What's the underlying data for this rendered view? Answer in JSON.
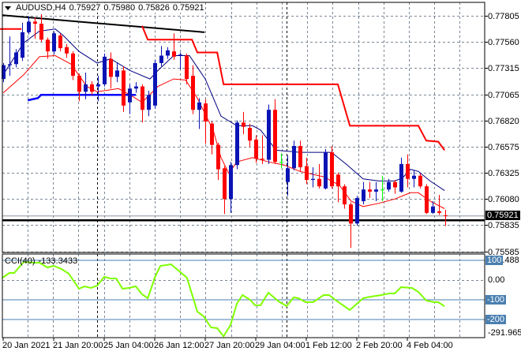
{
  "header": {
    "symbol": "AUDUSD,H4",
    "open": "0.75927",
    "high": "0.75980",
    "low": "0.75826",
    "close": "0.75921"
  },
  "cci": {
    "label": "CCI(40)",
    "value": "-133.3433",
    "scale_labels": [
      "0.00",
      "-291.9651"
    ],
    "max_label": "123.488",
    "level_labels": [
      "100",
      "-100",
      "-200"
    ],
    "color": "#7fff00"
  },
  "price_axis": {
    "labels": [
      "0.77805",
      "0.77560",
      "0.77315",
      "0.77065",
      "0.76820",
      "0.76575",
      "0.76325",
      "0.76080",
      "0.75835",
      "0.75585"
    ],
    "current_price": "0.75921"
  },
  "time_axis": {
    "labels": [
      "20 Jan 2021",
      "21 Jan 20:00",
      "25 Jan 04:00",
      "26 Jan 12:00",
      "27 Jan 20:00",
      "29 Jan 04:00",
      "1 Feb 12:00",
      "2 Feb 20:00",
      "4 Feb 04:00"
    ]
  },
  "colors": {
    "bull": "#0a14b4",
    "bear": "#ff0000",
    "doji": "#00ff00",
    "ma_fast": "#ff0000",
    "ma_slow": "#000080",
    "grid": "#7a8796",
    "trend": "#000000"
  },
  "chart_data": {
    "type": "candlestick",
    "symbol": "AUDUSD",
    "timeframe": "H4",
    "ylim": [
      0.75585,
      0.77805
    ],
    "candles": [
      [
        0.7721,
        0.7736,
        0.7718,
        0.7734
      ],
      [
        0.7734,
        0.7761,
        0.7724,
        0.7735
      ],
      [
        0.7735,
        0.7749,
        0.7732,
        0.7746
      ],
      [
        0.7741,
        0.7774,
        0.7738,
        0.7765
      ],
      [
        0.7765,
        0.778,
        0.7763,
        0.7775
      ],
      [
        0.7775,
        0.7779,
        0.7759,
        0.7773
      ],
      [
        0.7773,
        0.7782,
        0.7756,
        0.7758
      ],
      [
        0.7758,
        0.776,
        0.774,
        0.7747
      ],
      [
        0.7747,
        0.7766,
        0.7744,
        0.7764
      ],
      [
        0.7762,
        0.7764,
        0.7747,
        0.775
      ],
      [
        0.7751,
        0.7754,
        0.7741,
        0.7745
      ],
      [
        0.7745,
        0.7747,
        0.772,
        0.7724
      ],
      [
        0.7724,
        0.7726,
        0.77,
        0.7709
      ],
      [
        0.7709,
        0.7727,
        0.7702,
        0.7716
      ],
      [
        0.7716,
        0.7719,
        0.7706,
        0.7709
      ],
      [
        0.7714,
        0.7724,
        0.77,
        0.7716
      ],
      [
        0.7716,
        0.7745,
        0.7714,
        0.7742
      ],
      [
        0.774,
        0.7746,
        0.7712,
        0.7723
      ],
      [
        0.7723,
        0.7736,
        0.7718,
        0.7729
      ],
      [
        0.7729,
        0.7733,
        0.769,
        0.7696
      ],
      [
        0.7699,
        0.7716,
        0.7688,
        0.7712
      ],
      [
        0.7712,
        0.7718,
        0.7708,
        0.7714
      ],
      [
        0.7714,
        0.7716,
        0.768,
        0.7692
      ],
      [
        0.7692,
        0.771,
        0.7686,
        0.7706
      ],
      [
        0.7696,
        0.7739,
        0.7693,
        0.7736
      ],
      [
        0.7736,
        0.7752,
        0.7733,
        0.7743
      ],
      [
        0.7743,
        0.7751,
        0.774,
        0.7748
      ],
      [
        0.7747,
        0.7764,
        0.7739,
        0.7742
      ],
      [
        0.7743,
        0.7746,
        0.773,
        0.7744
      ],
      [
        0.7743,
        0.7745,
        0.7716,
        0.7721
      ],
      [
        0.7724,
        0.7734,
        0.7688,
        0.7692
      ],
      [
        0.7692,
        0.7703,
        0.7674,
        0.7699
      ],
      [
        0.7698,
        0.7702,
        0.766,
        0.7681
      ],
      [
        0.7679,
        0.7681,
        0.765,
        0.7659
      ],
      [
        0.7659,
        0.7661,
        0.7626,
        0.7636
      ],
      [
        0.7637,
        0.7639,
        0.7594,
        0.7608
      ],
      [
        0.7608,
        0.7643,
        0.7595,
        0.764
      ],
      [
        0.764,
        0.7682,
        0.7636,
        0.768
      ],
      [
        0.768,
        0.769,
        0.7669,
        0.7676
      ],
      [
        0.7675,
        0.7679,
        0.7657,
        0.7663
      ],
      [
        0.7664,
        0.7668,
        0.7642,
        0.7646
      ],
      [
        0.7646,
        0.7668,
        0.7641,
        0.7645
      ],
      [
        0.7645,
        0.7697,
        0.7641,
        0.7692
      ],
      [
        0.7692,
        0.7702,
        0.7641,
        0.7643
      ],
      [
        0.7643,
        0.7651,
        0.7637,
        0.7643
      ],
      [
        0.7624,
        0.7649,
        0.7611,
        0.7637
      ],
      [
        0.7637,
        0.7663,
        0.7635,
        0.7658
      ],
      [
        0.7658,
        0.7663,
        0.7634,
        0.7638
      ],
      [
        0.7639,
        0.7647,
        0.7622,
        0.7626
      ],
      [
        0.7626,
        0.7638,
        0.7619,
        0.7627
      ],
      [
        0.7627,
        0.7641,
        0.7618,
        0.762
      ],
      [
        0.7618,
        0.7655,
        0.7617,
        0.7652
      ],
      [
        0.7652,
        0.7658,
        0.7618,
        0.762
      ],
      [
        0.7631,
        0.7633,
        0.7605,
        0.762
      ],
      [
        0.762,
        0.7622,
        0.7599,
        0.7603
      ],
      [
        0.7603,
        0.7605,
        0.7562,
        0.7585
      ],
      [
        0.7585,
        0.7611,
        0.7583,
        0.7609
      ],
      [
        0.7606,
        0.7624,
        0.7603,
        0.7617
      ],
      [
        0.7617,
        0.7624,
        0.7609,
        0.7615
      ],
      [
        0.7615,
        0.7624,
        0.7606,
        0.7617
      ],
      [
        0.7617,
        0.763,
        0.7606,
        0.7617
      ],
      [
        0.7617,
        0.7627,
        0.7615,
        0.7624
      ],
      [
        0.7624,
        0.7626,
        0.7613,
        0.7619
      ],
      [
        0.7615,
        0.7647,
        0.7614,
        0.7641
      ],
      [
        0.7641,
        0.765,
        0.7619,
        0.7627
      ],
      [
        0.7627,
        0.7635,
        0.7619,
        0.763
      ],
      [
        0.763,
        0.7632,
        0.7618,
        0.762
      ],
      [
        0.762,
        0.7622,
        0.7594,
        0.7595
      ],
      [
        0.7595,
        0.7606,
        0.7594,
        0.7601
      ],
      [
        0.75965,
        0.7612,
        0.7593,
        0.7595
      ],
      [
        0.75927,
        0.7598,
        0.75826,
        0.75921
      ]
    ],
    "ma_slow": [
      [
        0,
        0.7725
      ],
      [
        3.25,
        0.7755
      ],
      [
        5.75,
        0.7766
      ],
      [
        8.25,
        0.7768
      ],
      [
        9.5,
        0.7762
      ],
      [
        12,
        0.7747
      ],
      [
        14.9,
        0.7736
      ],
      [
        17,
        0.774
      ],
      [
        20.1,
        0.7729
      ],
      [
        23.25,
        0.7721
      ],
      [
        24.5,
        0.7729
      ],
      [
        27,
        0.7743
      ],
      [
        29.5,
        0.7743
      ],
      [
        32,
        0.7721
      ],
      [
        34.5,
        0.7686
      ],
      [
        37,
        0.7677
      ],
      [
        39.5,
        0.7677
      ],
      [
        40.75,
        0.7673
      ],
      [
        43.25,
        0.7654
      ],
      [
        47,
        0.7652
      ],
      [
        52,
        0.7652
      ],
      [
        54.5,
        0.764
      ],
      [
        57,
        0.7627
      ],
      [
        59.5,
        0.7625
      ],
      [
        62,
        0.7625
      ],
      [
        63.25,
        0.7628
      ],
      [
        64.5,
        0.7636
      ],
      [
        65.75,
        0.7634
      ],
      [
        67.6,
        0.7625
      ],
      [
        69.9,
        0.7616
      ]
    ],
    "ma_fast": [
      [
        0,
        0.7708
      ],
      [
        3.25,
        0.7725
      ],
      [
        5.75,
        0.7742
      ],
      [
        8.25,
        0.7743
      ],
      [
        10.75,
        0.7735
      ],
      [
        13.25,
        0.7714
      ],
      [
        14.9,
        0.7709
      ],
      [
        18.25,
        0.7712
      ],
      [
        20.1,
        0.7706
      ],
      [
        22,
        0.7699
      ],
      [
        24.5,
        0.7714
      ],
      [
        27,
        0.7721
      ],
      [
        28.9,
        0.772
      ],
      [
        30.75,
        0.7703
      ],
      [
        33.25,
        0.7673
      ],
      [
        34.5,
        0.7647
      ],
      [
        35.75,
        0.7632
      ],
      [
        37,
        0.7643
      ],
      [
        39.5,
        0.7647
      ],
      [
        42,
        0.7643
      ],
      [
        44.5,
        0.764
      ],
      [
        47,
        0.7634
      ],
      [
        50.75,
        0.7629
      ],
      [
        53.25,
        0.7621
      ],
      [
        55.1,
        0.7606
      ],
      [
        57,
        0.7601
      ],
      [
        59.5,
        0.7604
      ],
      [
        62,
        0.7608
      ],
      [
        64.5,
        0.7614
      ],
      [
        65.75,
        0.7614
      ],
      [
        67.6,
        0.7606
      ],
      [
        69.9,
        0.7599
      ]
    ],
    "upper_stop": [
      [
        [
          -0.5,
          0.7768
        ],
        [
          2.9,
          0.7768
        ]
      ],
      [
        [
          22,
          0.7771
        ],
        [
          22.9,
          0.7758
        ],
        [
          29.9,
          0.7758
        ],
        [
          30.75,
          0.7746
        ],
        [
          33.9,
          0.7746
        ],
        [
          34.9,
          0.7716
        ],
        [
          53,
          0.7716
        ],
        [
          54.9,
          0.7677
        ],
        [
          65.75,
          0.7677
        ],
        [
          67,
          0.7663
        ],
        [
          68.9,
          0.7662
        ],
        [
          69.9,
          0.7654
        ]
      ]
    ],
    "lower_stop": [
      [
        3.9,
        0.7701
      ],
      [
        5.5,
        0.7703
      ],
      [
        6,
        0.7706
      ],
      [
        21,
        0.7706
      ]
    ],
    "trendline": [
      [
        -0.1,
        0.7781
      ],
      [
        31.9,
        0.7765
      ]
    ],
    "hlines": {
      "last_price": 0.75921,
      "support": 0.7588
    },
    "cci_values": [
      [
        -0.1,
        12
      ],
      [
        1,
        36
      ],
      [
        1.75,
        36
      ],
      [
        3.25,
        92
      ],
      [
        4.9,
        88
      ],
      [
        5.75,
        88
      ],
      [
        7,
        64
      ],
      [
        8,
        72
      ],
      [
        9.25,
        56
      ],
      [
        10.4,
        32
      ],
      [
        12,
        -44
      ],
      [
        12.9,
        -32
      ],
      [
        13.9,
        -40
      ],
      [
        14.9,
        -28
      ],
      [
        16,
        16
      ],
      [
        17,
        8
      ],
      [
        17.9,
        8
      ],
      [
        18.9,
        -44
      ],
      [
        19.9,
        -40
      ],
      [
        21,
        -32
      ],
      [
        22,
        -72
      ],
      [
        22.9,
        -92
      ],
      [
        24.1,
        20
      ],
      [
        24.9,
        72
      ],
      [
        26.6,
        80
      ],
      [
        27.9,
        44
      ],
      [
        29.1,
        12
      ],
      [
        30.75,
        -160
      ],
      [
        31.75,
        -184
      ],
      [
        32.9,
        -240
      ],
      [
        33.9,
        -244
      ],
      [
        34.9,
        -285
      ],
      [
        36,
        -228
      ],
      [
        37,
        -120
      ],
      [
        37.9,
        -76
      ],
      [
        39.1,
        -100
      ],
      [
        39.9,
        -128
      ],
      [
        40.75,
        -128
      ],
      [
        42,
        -64
      ],
      [
        43.6,
        -108
      ],
      [
        44.9,
        -132
      ],
      [
        46,
        -88
      ],
      [
        46.75,
        -92
      ],
      [
        47.9,
        -112
      ],
      [
        49.1,
        -112
      ],
      [
        50.75,
        -76
      ],
      [
        51.6,
        -76
      ],
      [
        52.9,
        -108
      ],
      [
        54.9,
        -152
      ],
      [
        57,
        -92
      ],
      [
        58.25,
        -84
      ],
      [
        59.9,
        -76
      ],
      [
        61.1,
        -68
      ],
      [
        62,
        -68
      ],
      [
        63,
        -36
      ],
      [
        64.75,
        -40
      ],
      [
        65.75,
        -60
      ],
      [
        67,
        -104
      ],
      [
        68.25,
        -112
      ],
      [
        68.9,
        -112
      ],
      [
        69.9,
        -133.3433
      ]
    ],
    "cci_levels": [
      100,
      -100,
      -200
    ],
    "period_separators": [
      14.9,
      44.9
    ]
  }
}
